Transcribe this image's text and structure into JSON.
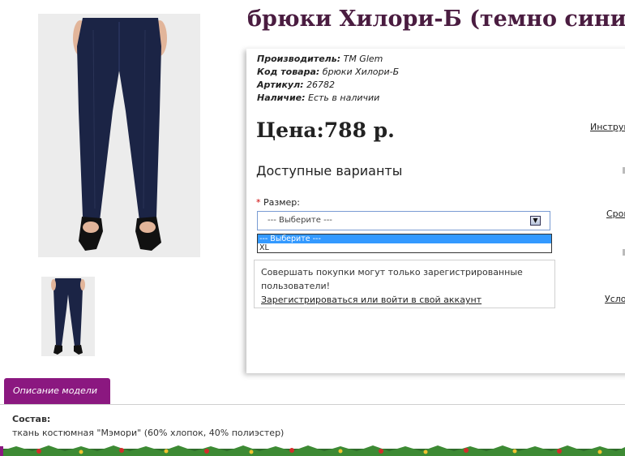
{
  "product": {
    "title": "брюки Хилори-Б (темно синий)",
    "manufacturer_label": "Производитель:",
    "manufacturer_value": "TM Glem",
    "code_label": "Код товара:",
    "code_value": "брюки Хилори-Б",
    "article_label": "Артикул:",
    "article_value": "26782",
    "availability_label": "Наличие:",
    "availability_value": "Есть в наличии",
    "price": "Цена:788 р."
  },
  "variants": {
    "title": "Доступные варианты",
    "required_mark": "*",
    "size_label": "Размер:",
    "select_value": "--- Выберите ---",
    "options": [
      "--- Выберите ---",
      "XL"
    ]
  },
  "notice": {
    "text": "Совершать покупки могут только зарегистрированные пользователи!",
    "link": "Зарегистрироваться или войти в свой аккаунт"
  },
  "side_links": {
    "instruction": "Инструк",
    "sizes": "Сром",
    "conditions": "Усло"
  },
  "tabs": {
    "description": "Описание модели"
  },
  "description": {
    "heading": "Состав:",
    "text": "ткань костюмная \"Мэмори\" (60% хлопок, 40% полиэстер)"
  },
  "colors": {
    "title": "#4a1c40",
    "tab": "#8b1880",
    "pants": "#1b2445"
  },
  "icons": {
    "select_arrow": "chevron-down-icon"
  }
}
